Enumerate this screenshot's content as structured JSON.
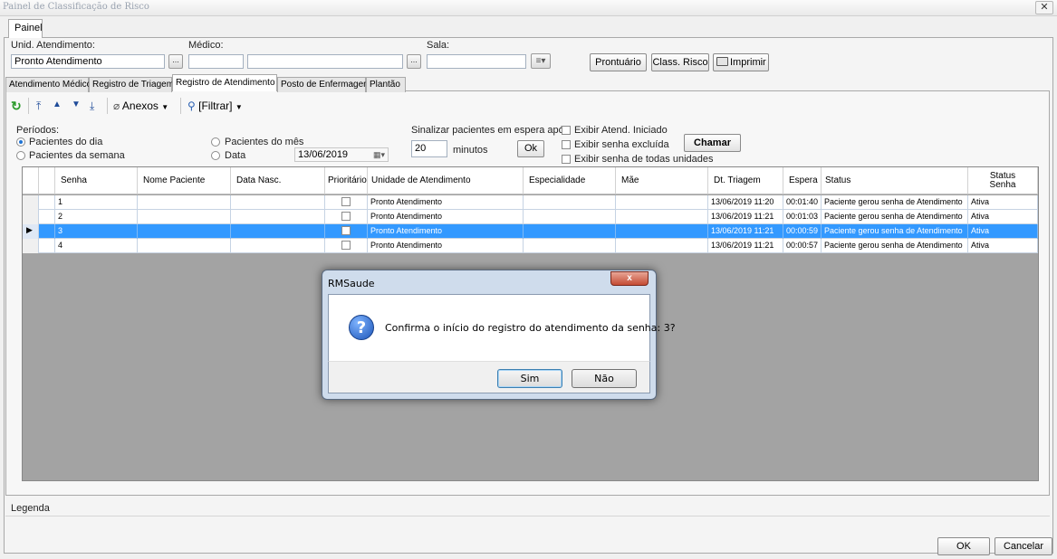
{
  "window": {
    "title": "Painel de Classificação de Risco",
    "close_glyph": "✕"
  },
  "outer_tab": "Painel",
  "form": {
    "unit_label": "Unid. Atendimento:",
    "unit_value": "Pronto Atendimento",
    "doctor_label": "Médico:",
    "room_label": "Sala:",
    "lookup_glyph": "...",
    "prontuario": "Prontuário",
    "class_risco": "Class. Risco",
    "imprimir": "Imprimir"
  },
  "inner_tabs": [
    "Atendimento Médico",
    "Registro de Triagem",
    "Registro de Atendimento",
    "Posto de Enfermagem",
    "Plantão"
  ],
  "toolbar": {
    "anexos": "Anexos",
    "filtrar": "[Filtrar]"
  },
  "periods": {
    "label": "Períodos:",
    "dia": "Pacientes do dia",
    "semana": "Pacientes da semana",
    "mes": "Pacientes do mês",
    "data": "Data",
    "date_value": "13/06/2019"
  },
  "signal": {
    "label": "Sinalizar pacientes em espera após",
    "value": "20",
    "unit": "minutos",
    "ok": "Ok"
  },
  "options": {
    "iniciado": "Exibir Atend. Iniciado",
    "excluida": "Exibir senha excluída",
    "todas": "Exibir senha de todas unidades",
    "chamar": "Chamar"
  },
  "grid": {
    "headers": {
      "senha": "Senha",
      "nome": "Nome Paciente",
      "nasc": "Data Nasc.",
      "prio": "Prioritário",
      "unidade": "Unidade de Atendimento",
      "esp": "Especialidade",
      "mae": "Mãe",
      "triagem": "Dt. Triagem",
      "espera": "Espera",
      "status": "Status",
      "status_senha_1": "Status",
      "status_senha_2": "Senha"
    },
    "rows": [
      {
        "senha": "1",
        "unidade": "Pronto Atendimento",
        "triagem": "13/06/2019 11:20",
        "espera": "00:01:40",
        "status": "Paciente gerou senha de Atendimento",
        "status_senha": "Ativa"
      },
      {
        "senha": "2",
        "unidade": "Pronto Atendimento",
        "triagem": "13/06/2019 11:21",
        "espera": "00:01:03",
        "status": "Paciente gerou senha de Atendimento",
        "status_senha": "Ativa"
      },
      {
        "senha": "3",
        "unidade": "Pronto Atendimento",
        "triagem": "13/06/2019 11:21",
        "espera": "00:00:59",
        "status": "Paciente gerou senha de Atendimento",
        "status_senha": "Ativa"
      },
      {
        "senha": "4",
        "unidade": "Pronto Atendimento",
        "triagem": "13/06/2019 11:21",
        "espera": "00:00:57",
        "status": "Paciente gerou senha de Atendimento",
        "status_senha": "Ativa"
      }
    ],
    "selected_index": 2
  },
  "legend": "Legenda",
  "footer": {
    "ok": "OK",
    "cancel": "Cancelar"
  },
  "dialog": {
    "title": "RMSaude",
    "close_glyph": "x",
    "icon_glyph": "?",
    "message": "Confirma o início do registro do atendimento da senha: 3?",
    "yes": "Sim",
    "no": "Não"
  }
}
